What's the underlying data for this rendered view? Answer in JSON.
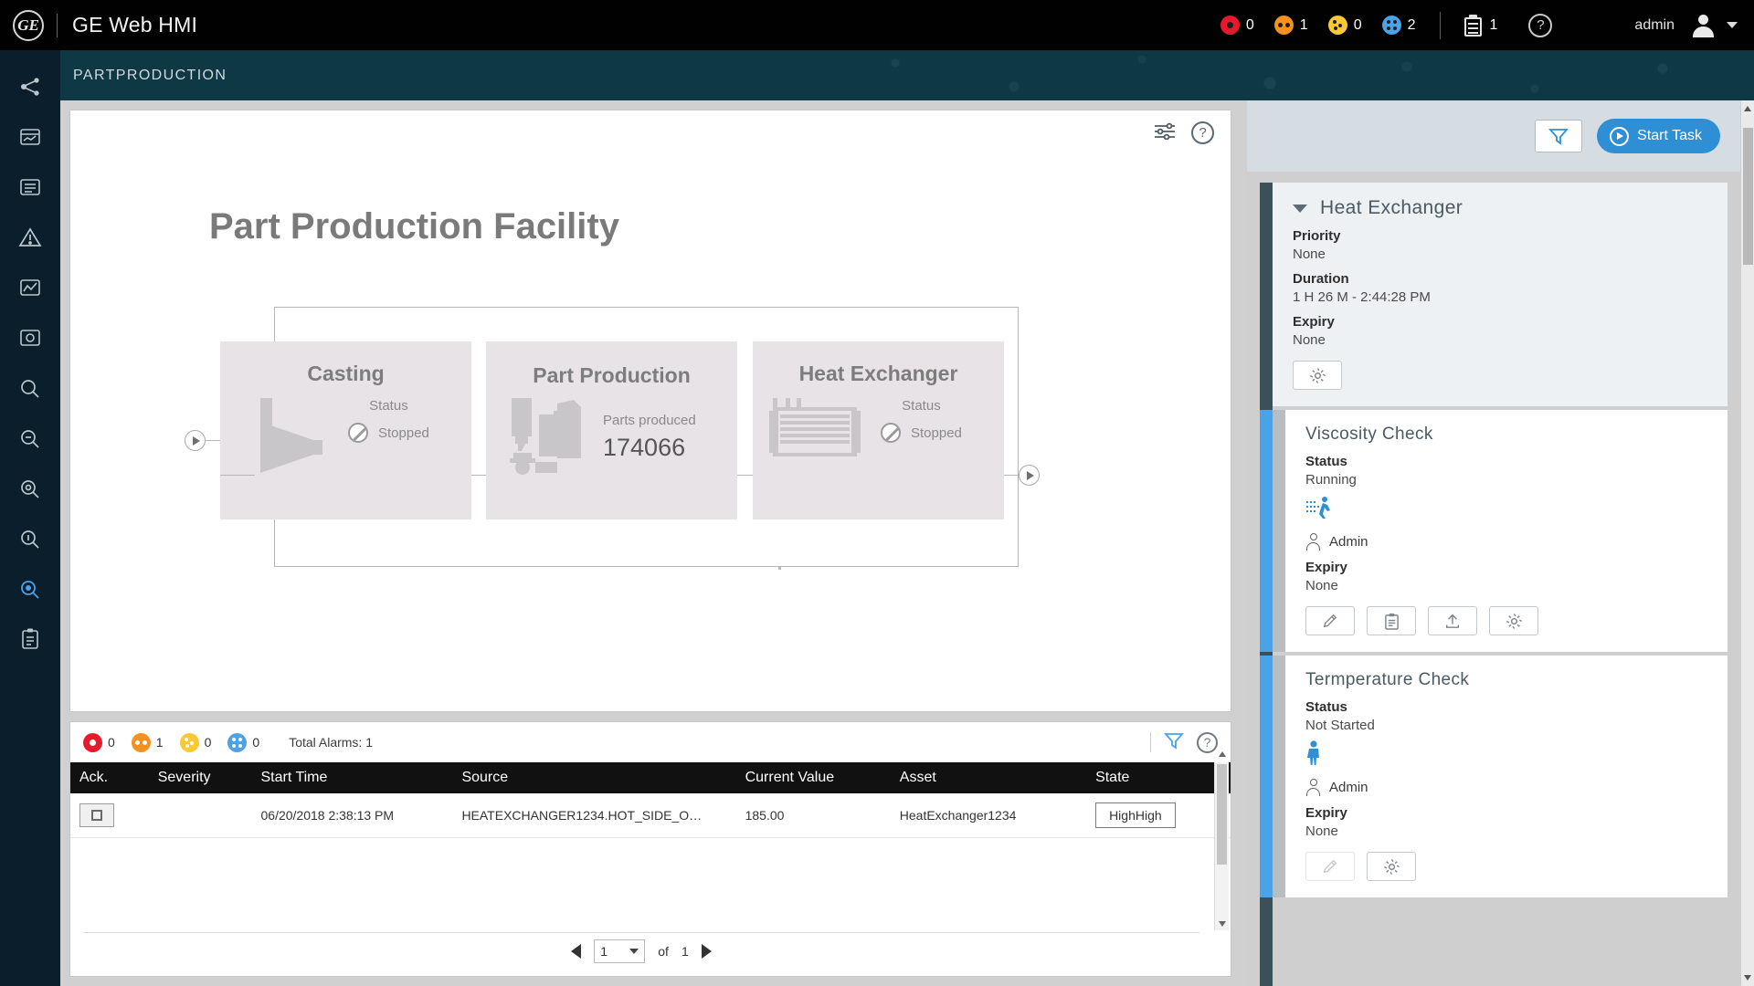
{
  "header": {
    "logo_alt": "ge-logo",
    "app_title": "GE Web HMI",
    "alarm_badges": [
      {
        "severity": "critical",
        "color": "#e8192c",
        "count": "0"
      },
      {
        "severity": "high",
        "color": "#f5911e",
        "count": "1"
      },
      {
        "severity": "medium",
        "color": "#fac832",
        "count": "0"
      },
      {
        "severity": "low",
        "color": "#4aa3e8",
        "count": "2"
      }
    ],
    "task_count": "1",
    "help_label": "?",
    "user_name": "admin"
  },
  "breadcrumb": {
    "text": "PARTPRODUCTION"
  },
  "sidebar": {
    "items": [
      {
        "name": "assets-network",
        "active": false
      },
      {
        "name": "trend-card",
        "active": false
      },
      {
        "name": "event-list",
        "active": false
      },
      {
        "name": "alarms-warning",
        "active": false
      },
      {
        "name": "analysis-chart",
        "active": false
      },
      {
        "name": "diagnostics",
        "active": false
      },
      {
        "name": "search-a",
        "active": false
      },
      {
        "name": "search-b",
        "active": false
      },
      {
        "name": "search-c",
        "active": false
      },
      {
        "name": "search-d",
        "active": false
      },
      {
        "name": "search-active",
        "active": true
      },
      {
        "name": "task-list",
        "active": false
      }
    ]
  },
  "mimic": {
    "title": "Part Production Facility",
    "help_label": "?",
    "boxes": [
      {
        "id": "casting",
        "title": "Casting",
        "status_label": "Status",
        "status_value": "Stopped",
        "icon": "funnel-machine-icon"
      },
      {
        "id": "part-production",
        "title": "Part Production",
        "metric_label": "Parts produced",
        "metric_value": "174066",
        "icon": "press-machine-icon"
      },
      {
        "id": "heat-exchanger",
        "title": "Heat Exchanger",
        "status_label": "Status",
        "status_value": "Stopped",
        "icon": "heat-exchanger-icon"
      }
    ]
  },
  "alarms": {
    "summary_badges": [
      {
        "severity": "critical",
        "color": "#e8192c",
        "count": "0"
      },
      {
        "severity": "high",
        "color": "#f5911e",
        "count": "1"
      },
      {
        "severity": "medium",
        "color": "#fac832",
        "count": "0"
      },
      {
        "severity": "low",
        "color": "#4aa3e8",
        "count": "0"
      }
    ],
    "total_label": "Total Alarms: 1",
    "help_label": "?",
    "columns": [
      "Ack.",
      "Severity",
      "Start Time",
      "Source",
      "Current Value",
      "Asset",
      "State"
    ],
    "rows": [
      {
        "ack": "",
        "severity_color": "#f5911e",
        "start_time": "06/20/2018 2:38:13 PM",
        "source": "HEATEXCHANGER1234.HOT_SIDE_O…",
        "current_value": "185.00",
        "asset": "HeatExchanger1234",
        "state": "HighHigh"
      }
    ],
    "pager": {
      "page": "1",
      "of_label": "of",
      "total_pages": "1"
    }
  },
  "task_panel": {
    "toolbar": {
      "filter_label": "filter-icon",
      "start_task_label": "Start Task"
    },
    "cards": [
      {
        "type": "parent",
        "title": "Heat  Exchanger",
        "fields": [
          {
            "label": "Priority",
            "value": "None"
          },
          {
            "label": "Duration",
            "value": "1 H 26 M - 2:44:28 PM"
          },
          {
            "label": "Expiry",
            "value": "None"
          }
        ],
        "buttons": [
          "gear-icon"
        ]
      },
      {
        "type": "child",
        "title": "Viscosity Check",
        "status_label": "Status",
        "status_value": "Running",
        "status_glyph": "running-person-icon",
        "assignee": "Admin",
        "fields": [
          {
            "label": "Expiry",
            "value": "None"
          }
        ],
        "buttons": [
          "pencil-icon",
          "clipboard-icon",
          "upload-icon",
          "gear-icon"
        ]
      },
      {
        "type": "child",
        "title": "Termperature Check",
        "status_label": "Status",
        "status_value": "Not Started",
        "status_glyph": "standing-person-icon",
        "assignee": "Admin",
        "fields": [
          {
            "label": "Expiry",
            "value": "None"
          }
        ],
        "buttons": [
          "pencil-icon",
          "gear-icon"
        ]
      }
    ]
  }
}
